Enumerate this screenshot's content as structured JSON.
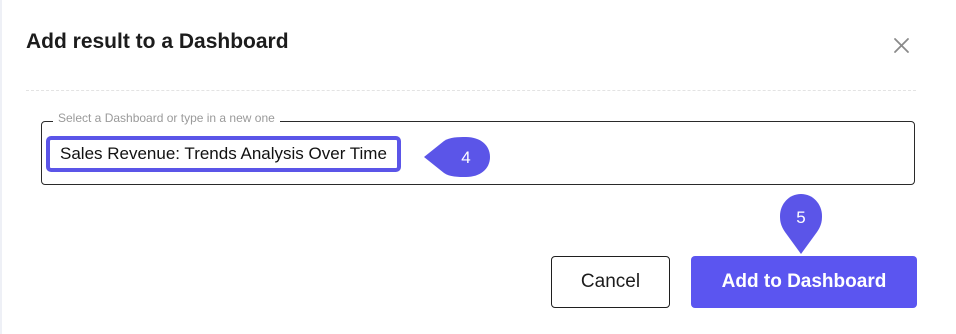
{
  "dialog": {
    "title": "Add result to a Dashboard"
  },
  "dashboard_field": {
    "legend": "Select a Dashboard or type in a new one",
    "value": "Sales Revenue: Trends Analysis Over Time"
  },
  "markers": {
    "field_step": "4",
    "button_step": "5"
  },
  "actions": {
    "cancel_label": "Cancel",
    "add_label": "Add to Dashboard"
  },
  "colors": {
    "accent": "#5b55f0",
    "marker": "#5b55e8"
  },
  "icons": {
    "close": "close-icon"
  }
}
